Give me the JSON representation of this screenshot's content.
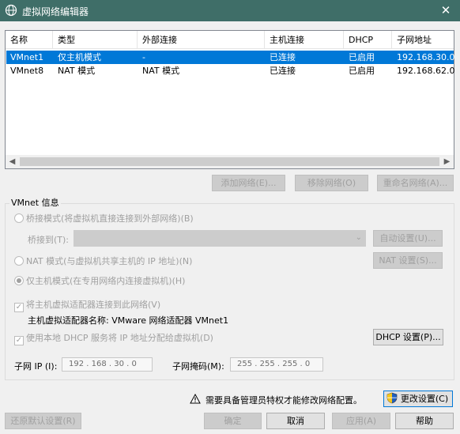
{
  "window": {
    "title": "虚拟网络编辑器",
    "close_glyph": "✕"
  },
  "network_list": {
    "columns": [
      "名称",
      "类型",
      "外部连接",
      "主机连接",
      "DHCP",
      "子网地址"
    ],
    "rows": [
      {
        "name": "VMnet1",
        "type": "仅主机模式",
        "external": "-",
        "host": "已连接",
        "dhcp": "已启用",
        "subnet": "192.168.30.0",
        "selected": true
      },
      {
        "name": "VMnet8",
        "type": "NAT 模式",
        "external": "NAT 模式",
        "host": "已连接",
        "dhcp": "已启用",
        "subnet": "192.168.62.0",
        "selected": false
      }
    ]
  },
  "list_buttons": {
    "add": "添加网络(E)...",
    "remove": "移除网络(O)",
    "rename": "重命名网络(A)..."
  },
  "vmnet_info": {
    "label": "VMnet 信息",
    "bridged": "桥接模式(将虚拟机直接连接到外部网络)(B)",
    "bridged_to_label": "桥接到(T):",
    "bridged_to_value": "",
    "auto_settings": "自动设置(U)...",
    "nat": "NAT 模式(与虚拟机共享主机的 IP 地址)(N)",
    "nat_settings": "NAT 设置(S)...",
    "host_only": "仅主机模式(在专用网络内连接虚拟机)(H)",
    "connect_adapter": "将主机虚拟适配器连接到此网络(V)",
    "adapter_name": "主机虚拟适配器名称: VMware 网络适配器 VMnet1",
    "use_dhcp": "使用本地 DHCP 服务将 IP 地址分配给虚拟机(D)",
    "dhcp_settings": "DHCP 设置(P)...",
    "subnet_ip_label": "子网 IP (I):",
    "subnet_ip": "192 . 168 . 30 . 0",
    "subnet_mask_label": "子网掩码(M):",
    "subnet_mask": "255 . 255 . 255 . 0"
  },
  "admin_notice": "需要具备管理员特权才能修改网络配置。",
  "change_settings": "更改设置(C)",
  "footer": {
    "restore_defaults": "还原默认设置(R)",
    "ok": "确定",
    "cancel": "取消",
    "apply": "应用(A)",
    "help": "帮助"
  },
  "colors": {
    "titlebar": "#3f6e68",
    "selection": "#0078d7"
  },
  "icons": {
    "app": "network-icon",
    "close": "close-icon",
    "warning": "warning-icon",
    "shield": "uac-shield-icon"
  }
}
